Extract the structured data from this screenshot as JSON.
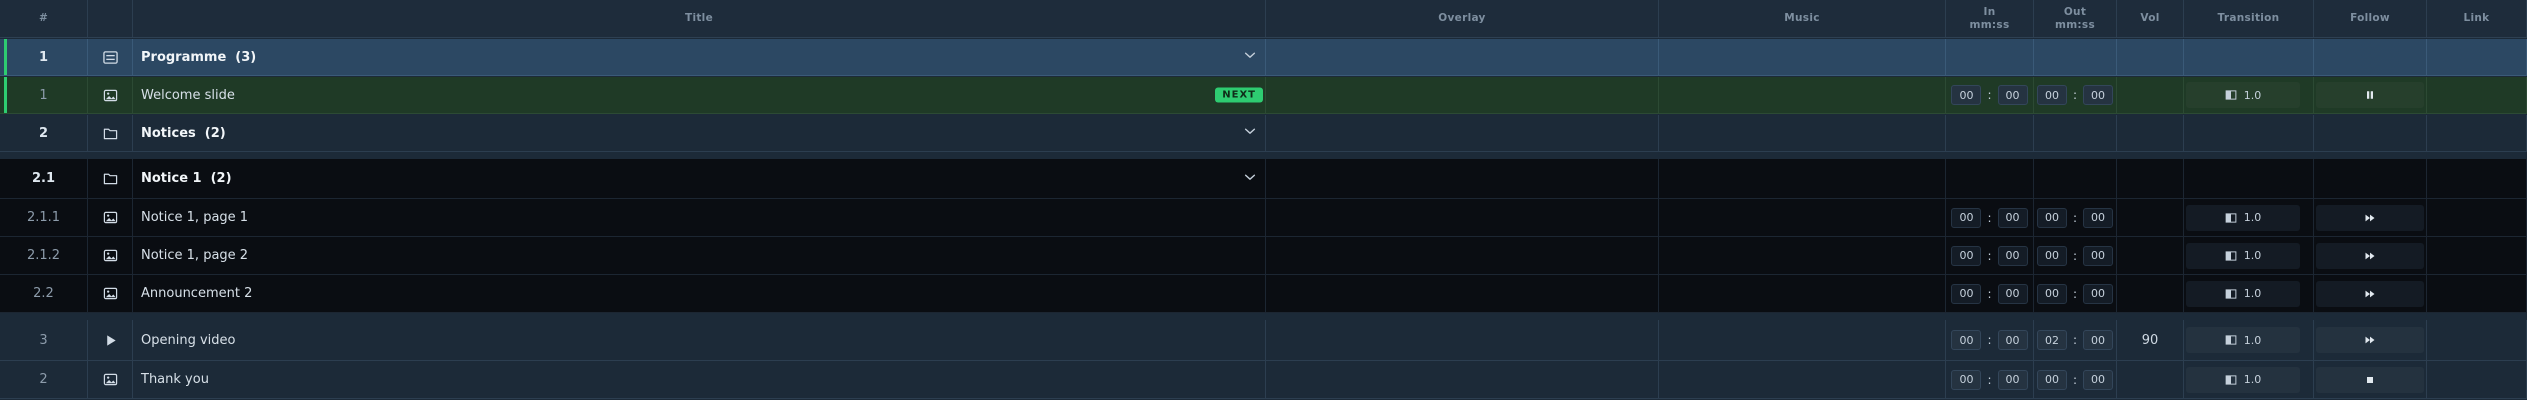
{
  "columns": [
    {
      "key": "num",
      "label": "#"
    },
    {
      "key": "icon",
      "label": ""
    },
    {
      "key": "title",
      "label": "Title"
    },
    {
      "key": "overlay",
      "label": "Overlay"
    },
    {
      "key": "music",
      "label": "Music"
    },
    {
      "key": "in",
      "label": "In",
      "sub": "mm:ss"
    },
    {
      "key": "out",
      "label": "Out",
      "sub": "mm:ss"
    },
    {
      "key": "vol",
      "label": "Vol"
    },
    {
      "key": "transition",
      "label": "Transition"
    },
    {
      "key": "follow",
      "label": "Follow"
    },
    {
      "key": "link",
      "label": "Link"
    }
  ],
  "rows": [
    {
      "type": "group",
      "style": "sel",
      "num": "1",
      "icon": "list-icon",
      "title": "Programme",
      "count": "(3)",
      "expand": "chevron-down-icon",
      "indicator": true
    },
    {
      "type": "item",
      "style": "next",
      "num": "1",
      "icon": "image-icon",
      "title": "Welcome slide",
      "badge": "NEXT",
      "in": [
        "00",
        "00"
      ],
      "out": [
        "00",
        "00"
      ],
      "vol": "",
      "transition": "1.0",
      "follow": "pause-icon",
      "indicator": true
    },
    {
      "type": "group",
      "style": "top",
      "num": "2",
      "icon": "folder-icon",
      "title": "Notices",
      "count": "(2)",
      "expand": "chevron-down-icon"
    },
    {
      "type": "group",
      "style": "dark",
      "num": "2.1",
      "icon": "folder-icon",
      "title": "Notice 1",
      "count": "(2)",
      "expand": "chevron-down-icon"
    },
    {
      "type": "item",
      "style": "dark",
      "num": "2.1.1",
      "icon": "image-icon",
      "title": "Notice 1, page 1",
      "in": [
        "00",
        "00"
      ],
      "out": [
        "00",
        "00"
      ],
      "vol": "",
      "transition": "1.0",
      "follow": "fast-forward-icon"
    },
    {
      "type": "item",
      "style": "dark",
      "num": "2.1.2",
      "icon": "image-icon",
      "title": "Notice 1, page 2",
      "in": [
        "00",
        "00"
      ],
      "out": [
        "00",
        "00"
      ],
      "vol": "",
      "transition": "1.0",
      "follow": "fast-forward-icon"
    },
    {
      "type": "item",
      "style": "dark",
      "num": "2.2",
      "icon": "image-icon",
      "title": "Announcement 2",
      "in": [
        "00",
        "00"
      ],
      "out": [
        "00",
        "00"
      ],
      "vol": "",
      "transition": "1.0",
      "follow": "fast-forward-icon"
    },
    {
      "type": "item",
      "style": "top",
      "num": "3",
      "icon": "play-icon",
      "title": "Opening video",
      "in": [
        "00",
        "00"
      ],
      "out": [
        "02",
        "00"
      ],
      "vol": "90",
      "transition": "1.0",
      "follow": "fast-forward-icon"
    },
    {
      "type": "item",
      "style": "top",
      "num": "2",
      "icon": "image-icon",
      "title": "Thank you",
      "in": [
        "00",
        "00"
      ],
      "out": [
        "00",
        "00"
      ],
      "vol": "",
      "transition": "1.0",
      "follow": "stop-icon"
    }
  ],
  "colors": {
    "accent": "#2ecc71",
    "selected": "#2c4863",
    "next": "#1f3a26",
    "dark": "#0a0d12"
  }
}
